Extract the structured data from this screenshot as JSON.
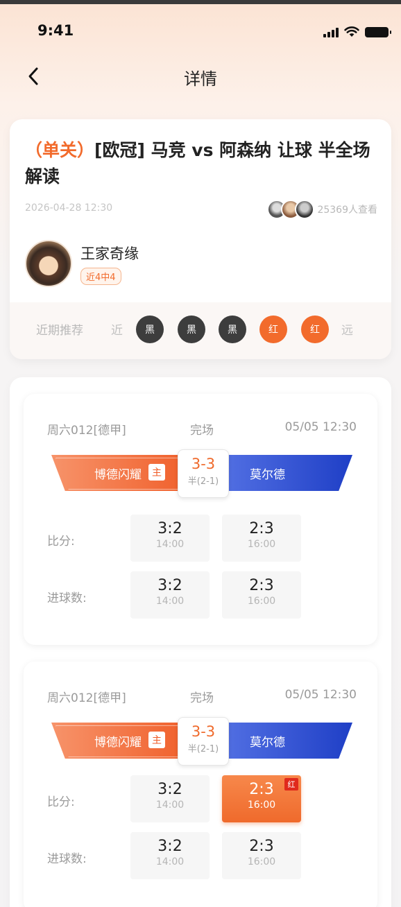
{
  "status_bar": {
    "time": "9:41"
  },
  "nav": {
    "title": "详情"
  },
  "article": {
    "tag": "（单关）",
    "title": "[欧冠] 马竞 vs 阿森纳 让球 半全场 解读",
    "date": "2026-04-28 12:30",
    "views": "25369人查看",
    "author": {
      "name": "王家奇缘",
      "badge": "近4中4"
    },
    "recent": {
      "label": "近期推荐",
      "near": "近",
      "far": "远",
      "results": [
        "黑",
        "黑",
        "黑",
        "红",
        "红"
      ]
    }
  },
  "matches": [
    {
      "league": "周六012[德甲]",
      "status": "完场",
      "time": "05/05 12:30",
      "home": "博德闪耀",
      "home_tag": "主",
      "away": "莫尔德",
      "score": "3-3",
      "half": "半(2-1)",
      "rows": [
        {
          "label": "比分:",
          "cells": [
            {
              "value": "3:2",
              "time": "14:00"
            },
            {
              "value": "2:3",
              "time": "16:00"
            }
          ]
        },
        {
          "label": "进球数:",
          "cells": [
            {
              "value": "3:2",
              "time": "14:00"
            },
            {
              "value": "2:3",
              "time": "16:00"
            }
          ]
        }
      ]
    },
    {
      "league": "周六012[德甲]",
      "status": "完场",
      "time": "05/05 12:30",
      "home": "博德闪耀",
      "home_tag": "主",
      "away": "莫尔德",
      "score": "3-3",
      "half": "半(2-1)",
      "hit_badge": "红",
      "rows": [
        {
          "label": "比分:",
          "cells": [
            {
              "value": "3:2",
              "time": "14:00"
            },
            {
              "value": "2:3",
              "time": "16:00"
            }
          ]
        },
        {
          "label": "进球数:",
          "cells": [
            {
              "value": "3:2",
              "time": "14:00"
            },
            {
              "value": "2:3",
              "time": "16:00"
            }
          ]
        }
      ]
    }
  ]
}
